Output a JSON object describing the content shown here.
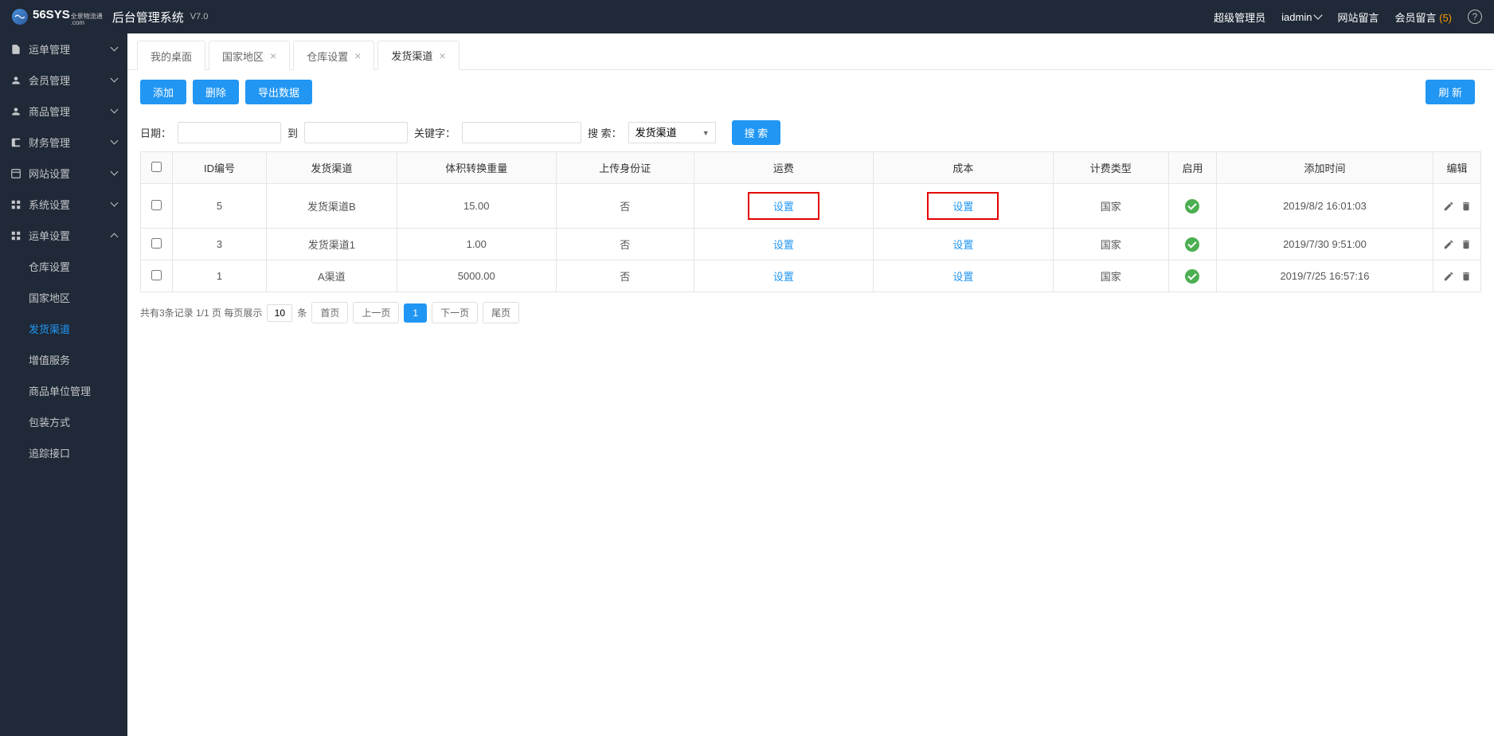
{
  "header": {
    "logo_main": "56SYS",
    "logo_sub": "全景物流通",
    "logo_dom": ".com",
    "title": "后台管理系统",
    "version": "V7.0",
    "role": "超级管理员",
    "user": "iadmin",
    "link_site_msg": "网站留言",
    "link_member_msg": "会员留言",
    "member_msg_count": "(5)"
  },
  "sidebar": {
    "groups": [
      {
        "label": "运单管理",
        "icon": "doc"
      },
      {
        "label": "会员管理",
        "icon": "user"
      },
      {
        "label": "商品管理",
        "icon": "user"
      },
      {
        "label": "财务管理",
        "icon": "wallet"
      },
      {
        "label": "网站设置",
        "icon": "layout"
      },
      {
        "label": "系统设置",
        "icon": "grid"
      }
    ],
    "expanded": {
      "label": "运单设置",
      "icon": "grid",
      "children": [
        {
          "label": "仓库设置"
        },
        {
          "label": "国家地区"
        },
        {
          "label": "发货渠道",
          "active": true
        },
        {
          "label": "增值服务"
        },
        {
          "label": "商品单位管理"
        },
        {
          "label": "包装方式"
        },
        {
          "label": "追踪接口"
        }
      ]
    }
  },
  "tabs": [
    {
      "label": "我的桌面",
      "closable": false
    },
    {
      "label": "国家地区",
      "closable": true
    },
    {
      "label": "仓库设置",
      "closable": true
    },
    {
      "label": "发货渠道",
      "closable": true,
      "active": true
    }
  ],
  "toolbar": {
    "add": "添加",
    "delete": "删除",
    "export": "导出数据",
    "refresh": "刷 新"
  },
  "filter": {
    "date_label": "日期：",
    "date_to": "到",
    "keyword_label": "关键字：",
    "search_label": "搜 索：",
    "select_value": "发货渠道",
    "search_btn": "搜 索"
  },
  "table": {
    "headers": [
      "ID编号",
      "发货渠道",
      "体积转换重量",
      "上传身份证",
      "运费",
      "成本",
      "计费类型",
      "启用",
      "添加时间",
      "编辑"
    ],
    "set_link": "设置",
    "rows": [
      {
        "id": "5",
        "channel": "发货渠道B",
        "weight": "15.00",
        "idcard": "否",
        "type": "国家",
        "time": "2019/8/2 16:01:03",
        "highlight": true
      },
      {
        "id": "3",
        "channel": "发货渠道1",
        "weight": "1.00",
        "idcard": "否",
        "type": "国家",
        "time": "2019/7/30 9:51:00",
        "highlight": false
      },
      {
        "id": "1",
        "channel": "A渠道",
        "weight": "5000.00",
        "idcard": "否",
        "type": "国家",
        "time": "2019/7/25 16:57:16",
        "highlight": false
      }
    ]
  },
  "pagination": {
    "info": "共有3条记录  1/1 页  每页展示",
    "per_page": "10",
    "unit": "条",
    "first": "首页",
    "prev": "上一页",
    "current": "1",
    "next": "下一页",
    "last": "尾页"
  }
}
